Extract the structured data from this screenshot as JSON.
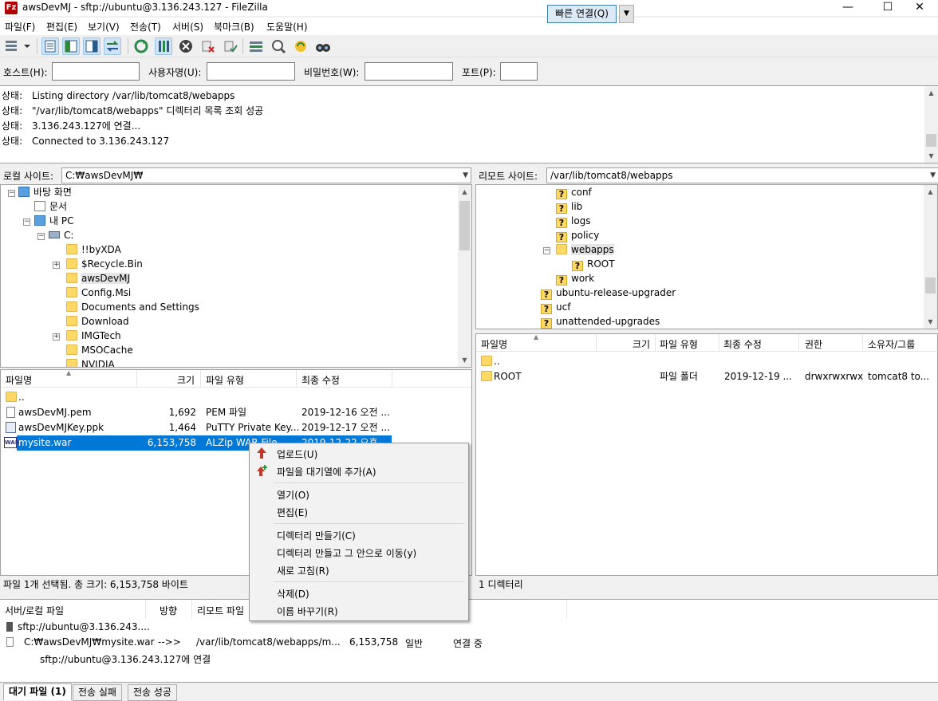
{
  "window": {
    "title": "awsDevMJ - sftp://ubuntu@3.136.243.127 - FileZilla",
    "app_icon": "Fz",
    "minimize": "—",
    "maximize": "☐",
    "close": "✕"
  },
  "menu": [
    "파일(F)",
    "편집(E)",
    "보기(V)",
    "전송(T)",
    "서버(S)",
    "북마크(B)",
    "도움말(H)"
  ],
  "quickconnect": {
    "host_label": "호스트(H):",
    "host_value": "",
    "user_label": "사용자명(U):",
    "user_value": "",
    "pass_label": "비밀번호(W):",
    "pass_value": "",
    "port_label": "포트(P):",
    "port_value": "",
    "connect_button": "빠른 연결(Q)"
  },
  "log": [
    {
      "key": "상태:",
      "msg": "Listing directory /var/lib/tomcat8/webapps"
    },
    {
      "key": "상태:",
      "msg": "\"/var/lib/tomcat8/webapps\" 디렉터리 목록 조회 성공"
    },
    {
      "key": "상태:",
      "msg": "3.136.243.127에 연결..."
    },
    {
      "key": "상태:",
      "msg": "Connected to 3.136.243.127"
    }
  ],
  "local": {
    "site_label": "로컬 사이트:",
    "path": "C:₩awsDevMJ₩",
    "tree": [
      "바탕 화면",
      "문서",
      "내 PC",
      "C:",
      "!!byXDA",
      "$Recycle.Bin",
      "awsDevMJ",
      "Config.Msi",
      "Documents and Settings",
      "Download",
      "IMGTech",
      "MSOCache",
      "NVIDIA"
    ],
    "columns": [
      "파일명",
      "크기",
      "파일 유형",
      "최종 수정"
    ],
    "files": [
      {
        "name": "..",
        "size": "",
        "type": "",
        "modified": ""
      },
      {
        "name": "awsDevMJ.pem",
        "size": "1,692",
        "type": "PEM 파일",
        "modified": "2019-12-16 오전 ..."
      },
      {
        "name": "awsDevMJKey.ppk",
        "size": "1,464",
        "type": "PuTTY Private Key...",
        "modified": "2019-12-17 오전 ..."
      },
      {
        "name": "mysite.war",
        "size": "6,153,758",
        "type": "ALZip WAR File",
        "modified": "2019-12-22 오후 ..."
      }
    ],
    "status": "파일 1개 선택됨. 총 크기: 6,153,758 바이트"
  },
  "remote": {
    "site_label": "리모트 사이트:",
    "path": "/var/lib/tomcat8/webapps",
    "tree": [
      "conf",
      "lib",
      "logs",
      "policy",
      "webapps",
      "ROOT",
      "work",
      "ubuntu-release-upgrader",
      "ucf",
      "unattended-upgrades"
    ],
    "columns": [
      "파일명",
      "크기",
      "파일 유형",
      "최종 수정",
      "권한",
      "소유자/그룹"
    ],
    "files": [
      {
        "name": "..",
        "size": "",
        "type": "",
        "modified": "",
        "perm": "",
        "owner": ""
      },
      {
        "name": "ROOT",
        "size": "",
        "type": "파일 폴더",
        "modified": "2019-12-19 ...",
        "perm": "drwxrwxrwx",
        "owner": "tomcat8 to..."
      }
    ],
    "status": "1 디렉터리"
  },
  "context_menu": {
    "items": [
      "업로드(U)",
      "파일을 대기열에 추가(A)",
      "열기(O)",
      "편집(E)",
      "디렉터리 만들기(C)",
      "디렉터리 만들고 그 안으로 이동(y)",
      "새로 고침(R)",
      "삭제(D)",
      "이름 바꾸기(R)"
    ]
  },
  "queue": {
    "columns": [
      "서버/로컬 파일",
      "방향",
      "리모트 파일"
    ],
    "server": "sftp://ubuntu@3.136.243....",
    "local_file": "C:₩awsDevMJ₩mysite.war",
    "direction": "-->>",
    "remote_file": "/var/lib/tomcat8/webapps/m...",
    "size": "6,153,758",
    "priority": "일반",
    "state": "연결 중",
    "status_line": "sftp://ubuntu@3.136.243.127에 연결"
  },
  "tabs": [
    "대기 파일 (1)",
    "전송 실패",
    "전송 성공"
  ],
  "colors": {
    "selection": "#0078d7",
    "folder": "#ffd966",
    "upload_arrow": "#c0392b"
  }
}
